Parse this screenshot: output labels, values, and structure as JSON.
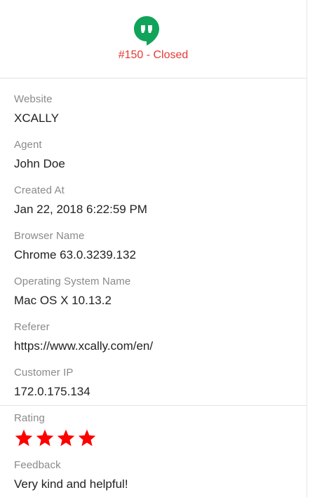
{
  "header": {
    "icon": "hangouts-quote-icon",
    "icon_color": "#10a35a",
    "status_color": "#e53935",
    "ticket_status": "#150 - Closed"
  },
  "details": [
    {
      "label": "Website",
      "value": "XCALLY"
    },
    {
      "label": "Agent",
      "value": "John Doe"
    },
    {
      "label": "Created At",
      "value": "Jan 22, 2018 6:22:59 PM"
    },
    {
      "label": "Browser Name",
      "value": "Chrome 63.0.3239.132"
    },
    {
      "label": "Operating System Name",
      "value": "Mac OS X 10.13.2"
    },
    {
      "label": "Referer",
      "value": "https://www.xcally.com/en/"
    },
    {
      "label": "Customer IP",
      "value": "172.0.175.134"
    }
  ],
  "rating": {
    "label": "Rating",
    "stars": 4,
    "max_stars": 4,
    "star_color": "#ff0000",
    "icon": "star-icon"
  },
  "feedback": {
    "label": "Feedback",
    "value": "Very kind and helpful!"
  }
}
